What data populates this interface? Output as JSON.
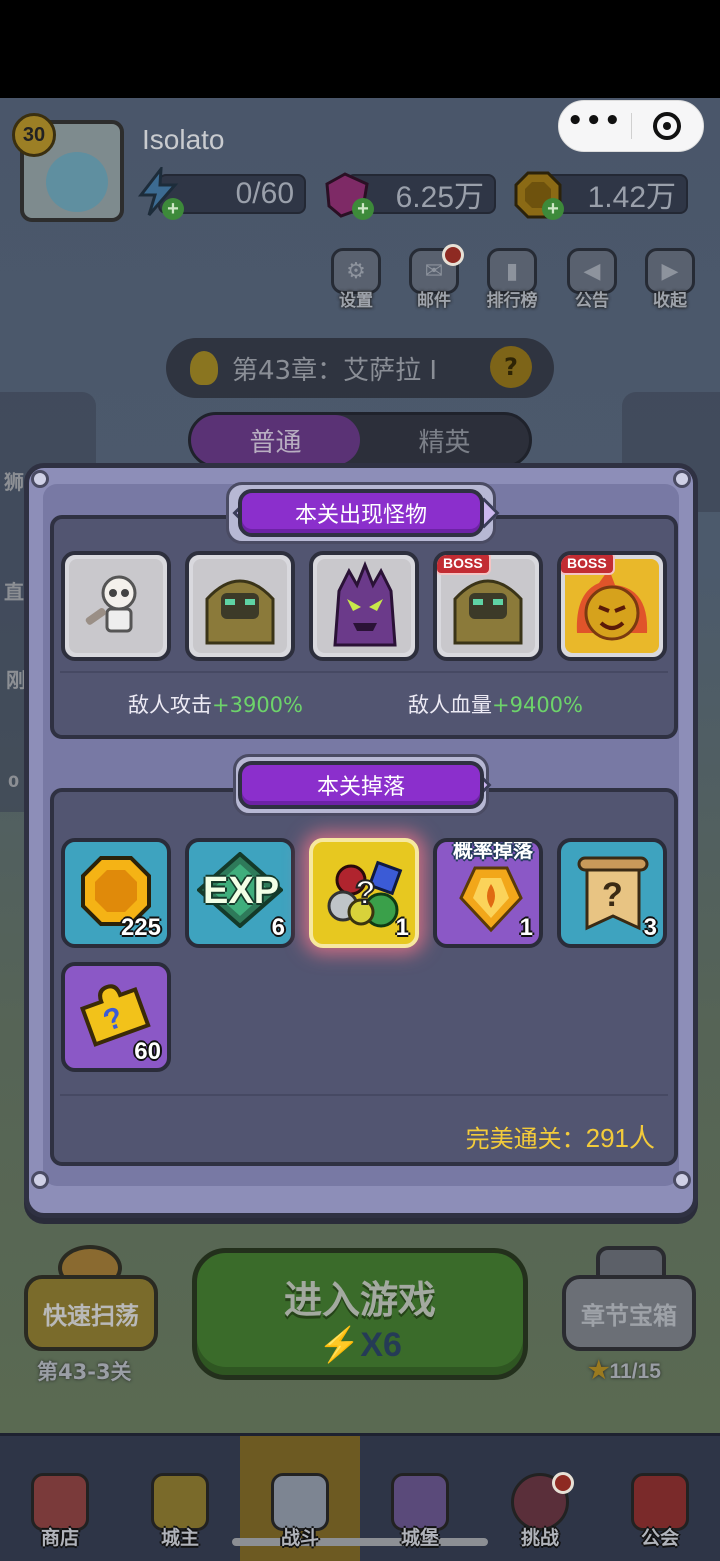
{
  "player": {
    "level": "30",
    "name": "Isolato"
  },
  "resources": {
    "energy": "0/60",
    "gems": "6.25万",
    "coins": "1.42万"
  },
  "top_menu": [
    "设置",
    "邮件",
    "排行榜",
    "公告",
    "收起"
  ],
  "chapter": {
    "title": "第43章：艾萨拉 I",
    "help": "?"
  },
  "mode_tabs": {
    "normal": "普通",
    "elite": "精英"
  },
  "side_left_labels": [
    "狮",
    "直",
    "刚",
    "0"
  ],
  "modal": {
    "monsters_title": "本关出现怪物",
    "boss_tag": "BOSS",
    "enemy_attack_label": "敌人攻击",
    "enemy_attack_value": "+3900%",
    "enemy_hp_label": "敌人血量",
    "enemy_hp_value": "+9400%",
    "drops_title": "本关掉落",
    "prob_drop": "概率掉落",
    "drops": [
      {
        "icon": "coin",
        "count": "225"
      },
      {
        "icon": "exp",
        "label": "EXP",
        "count": "6"
      },
      {
        "icon": "mystery-gems",
        "count": "1"
      },
      {
        "icon": "fire-crystal",
        "count": "1"
      },
      {
        "icon": "mystery-scroll",
        "count": "3"
      },
      {
        "icon": "puzzle-piece",
        "count": "60"
      }
    ],
    "perfect_clear_label": "完美通关：",
    "perfect_clear_count": "291人"
  },
  "bottom": {
    "quick_sweep": "快速扫荡",
    "quick_stage": "第43-3关",
    "enter_game": "进入游戏",
    "enter_cost": "X6",
    "chapter_chest": "章节宝箱",
    "chest_progress": "11/15"
  },
  "nav": [
    {
      "label": "商店",
      "active": false
    },
    {
      "label": "城主",
      "active": false
    },
    {
      "label": "战斗",
      "active": true
    },
    {
      "label": "城堡",
      "active": false
    },
    {
      "label": "挑战",
      "active": false
    },
    {
      "label": "公会",
      "active": false
    }
  ],
  "colors": {
    "banner_purple": "#8b2fcc",
    "positive_green": "#6dd36a",
    "gold_text": "#f3cb3a",
    "modal_bg": "#8d8eb8"
  }
}
